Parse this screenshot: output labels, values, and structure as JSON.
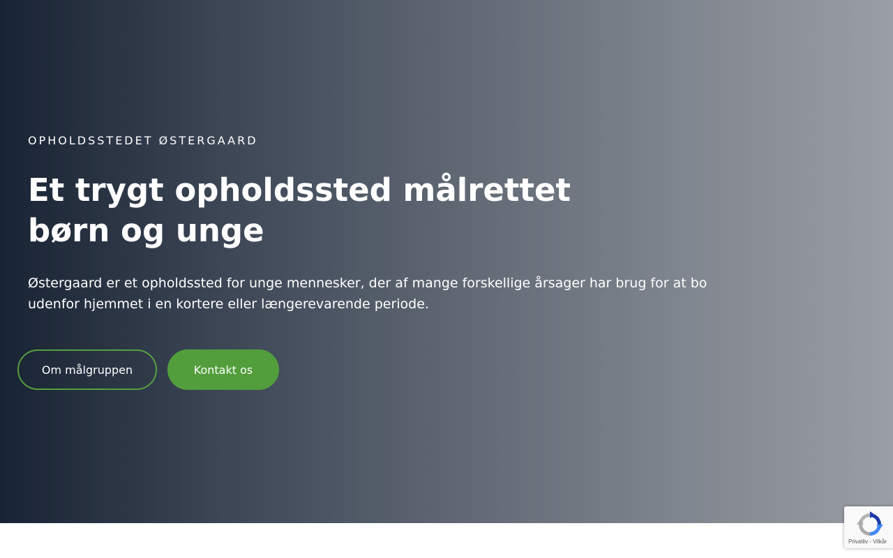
{
  "hero": {
    "eyebrow": "OPHOLDSSTEDET ØSTERGAARD",
    "headline": "Et trygt opholdssted målrettet børn og unge",
    "lead": "Østergaard er et opholdssted for unge mennesker, der af mange forskellige årsager har brug for at bo udenfor hjemmet i en kortere eller længerevarende periode.",
    "buttons": {
      "primary_label": "Om målgruppen",
      "secondary_label": "Kontakt os"
    }
  },
  "recaptcha": {
    "icon": "recaptcha-icon",
    "links": "Privatliv - Vilkår"
  },
  "colors": {
    "accent": "#529d3c",
    "gradient_start": "#182333",
    "gradient_end": "#9a9ea5"
  }
}
